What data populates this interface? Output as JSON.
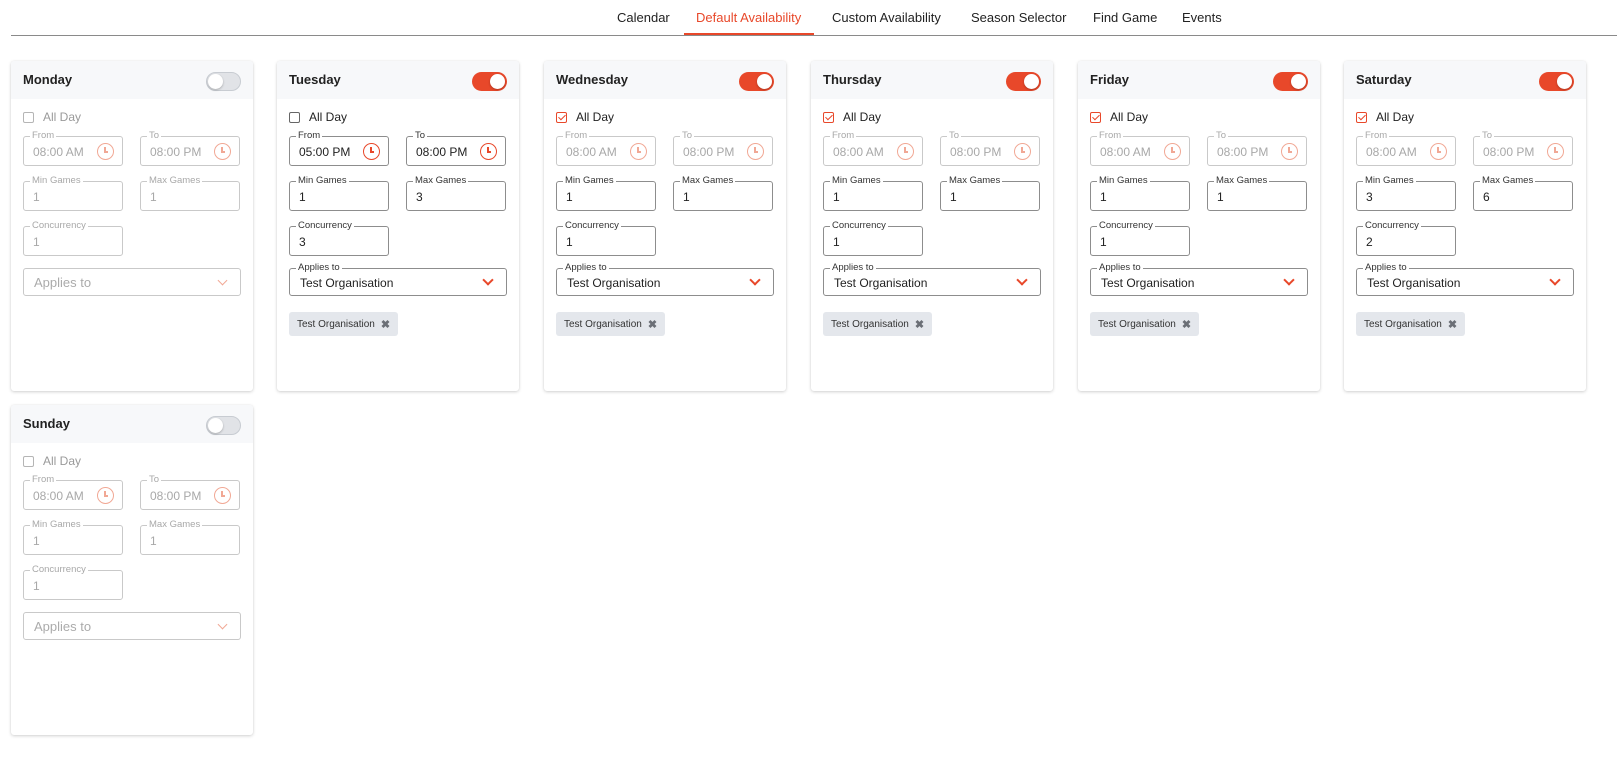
{
  "nav": {
    "tabs": [
      {
        "label": "Calendar"
      },
      {
        "label": "Default Availability"
      },
      {
        "label": "Custom Availability"
      },
      {
        "label": "Season Selector"
      },
      {
        "label": "Find Game"
      },
      {
        "label": "Events"
      }
    ],
    "active_tab": "Default Availability"
  },
  "labels": {
    "all_day": "All Day",
    "from": "From",
    "to": "To",
    "min_games": "Min Games",
    "max_games": "Max Games",
    "concurrency": "Concurrency",
    "applies_to": "Applies to"
  },
  "colors": {
    "accent": "#e8482a",
    "chip_bg": "#e4e7ec",
    "header_bg": "#f7f8fa"
  },
  "icons": {
    "time": "clock-icon",
    "dropdown": "chevron-down-icon",
    "remove": "close-icon"
  },
  "days": [
    {
      "name": "Monday",
      "enabled": false,
      "all_day": false,
      "from": "08:00 AM",
      "to": "08:00 PM",
      "min_games": "1",
      "max_games": "1",
      "concurrency": "1",
      "applies_to": "",
      "chips": []
    },
    {
      "name": "Tuesday",
      "enabled": true,
      "all_day": false,
      "from": "05:00 PM",
      "to": "08:00 PM",
      "min_games": "1",
      "max_games": "3",
      "concurrency": "3",
      "applies_to": "Test Organisation",
      "chips": [
        "Test Organisation"
      ]
    },
    {
      "name": "Wednesday",
      "enabled": true,
      "all_day": true,
      "from": "08:00 AM",
      "to": "08:00 PM",
      "min_games": "1",
      "max_games": "1",
      "concurrency": "1",
      "applies_to": "Test Organisation",
      "chips": [
        "Test Organisation"
      ]
    },
    {
      "name": "Thursday",
      "enabled": true,
      "all_day": true,
      "from": "08:00 AM",
      "to": "08:00 PM",
      "min_games": "1",
      "max_games": "1",
      "concurrency": "1",
      "applies_to": "Test Organisation",
      "chips": [
        "Test Organisation"
      ]
    },
    {
      "name": "Friday",
      "enabled": true,
      "all_day": true,
      "from": "08:00 AM",
      "to": "08:00 PM",
      "min_games": "1",
      "max_games": "1",
      "concurrency": "1",
      "applies_to": "Test Organisation",
      "chips": [
        "Test Organisation"
      ]
    },
    {
      "name": "Saturday",
      "enabled": true,
      "all_day": true,
      "from": "08:00 AM",
      "to": "08:00 PM",
      "min_games": "3",
      "max_games": "6",
      "concurrency": "2",
      "applies_to": "Test Organisation",
      "chips": [
        "Test Organisation"
      ]
    },
    {
      "name": "Sunday",
      "enabled": false,
      "all_day": false,
      "from": "08:00 AM",
      "to": "08:00 PM",
      "min_games": "1",
      "max_games": "1",
      "concurrency": "1",
      "applies_to": "",
      "chips": []
    }
  ]
}
